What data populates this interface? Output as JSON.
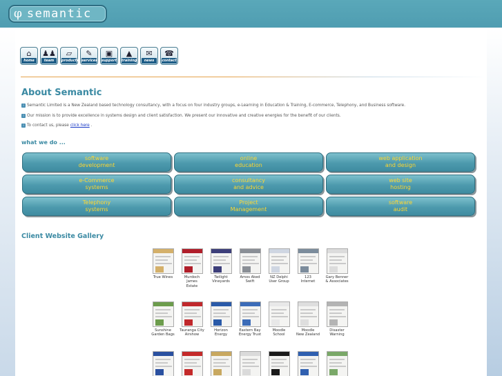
{
  "header": {
    "logo_symbol": "φ",
    "logo_word": "semantic"
  },
  "nav": [
    {
      "label": "home",
      "icon": "house-icon",
      "glyph": "⌂"
    },
    {
      "label": "team",
      "icon": "people-icon",
      "glyph": "♟♟"
    },
    {
      "label": "products",
      "icon": "box-icon",
      "glyph": "▱"
    },
    {
      "label": "services",
      "icon": "tools-icon",
      "glyph": "✎"
    },
    {
      "label": "support",
      "icon": "monitor-icon",
      "glyph": "▣"
    },
    {
      "label": "training",
      "icon": "graduation-cap-icon",
      "glyph": "▲"
    },
    {
      "label": "news",
      "icon": "megaphone-icon",
      "glyph": "✉"
    },
    {
      "label": "contact",
      "icon": "telephone-icon",
      "glyph": "☎"
    }
  ],
  "about": {
    "title": "About Semantic",
    "p1": "Semantic Limited is a New Zealand based technology consultancy, with a focus on four industry groups, e-Learning in Education & Training, E-commerce, Telephony, and Business software.",
    "p2": "Our mission is to provide excellence in systems design and client satisfaction. We present our innovative and creative energies for the benefit of our clients.",
    "p3_prefix": "To contact us, please ",
    "p3_link": "click here",
    "p3_suffix": "."
  },
  "what_we_do": {
    "heading": "what we do ...",
    "services": [
      {
        "line1": "software",
        "line2": "development"
      },
      {
        "line1": "online",
        "line2": "education"
      },
      {
        "line1": "web application",
        "line2": "and design"
      },
      {
        "line1": "e-Commerce",
        "line2": "systems"
      },
      {
        "line1": "consultancy",
        "line2": "and advice"
      },
      {
        "line1": "web site",
        "line2": "hosting"
      },
      {
        "line1": "Telephony",
        "line2": "systems"
      },
      {
        "line1": "Project",
        "line2": "Management"
      },
      {
        "line1": "software",
        "line2": "audit"
      }
    ]
  },
  "gallery": {
    "heading": "Client Website Gallery",
    "rows": [
      [
        {
          "c1": "True Wines",
          "c2": "",
          "c3": "",
          "color": "#d4b06a"
        },
        {
          "c1": "Murdoch",
          "c2": "James",
          "c3": "Estate",
          "color": "#b01e2a"
        },
        {
          "c1": "Twilight",
          "c2": "Vineyards",
          "c3": "",
          "color": "#3d3f7a"
        },
        {
          "c1": "Amos Aked",
          "c2": "Swift",
          "c3": "",
          "color": "#8a8f96"
        },
        {
          "c1": "NZ Delphi",
          "c2": "User Group",
          "c3": "",
          "color": "#cfd6e2"
        },
        {
          "c1": "123",
          "c2": "Internet",
          "c3": "",
          "color": "#7c8c9c"
        },
        {
          "c1": "Gary Benner",
          "c2": "& Associates",
          "c3": "",
          "color": "#dcdcdc"
        }
      ],
      [
        {
          "c1": "Sunshine",
          "c2": "Garden Bags",
          "c3": "",
          "color": "#6c9c4c"
        },
        {
          "c1": "Tauranga City",
          "c2": "Airshow",
          "c3": "",
          "color": "#c0282c"
        },
        {
          "c1": "Horizon",
          "c2": "Energy",
          "c3": "",
          "color": "#2a5aa8"
        },
        {
          "c1": "Eastern Bay",
          "c2": "Energy Trust",
          "c3": "",
          "color": "#3c6cb8"
        },
        {
          "c1": "Moodle",
          "c2": "School",
          "c3": "",
          "color": "#e8e8e8"
        },
        {
          "c1": "Moodle",
          "c2": "New Zealand",
          "c3": "",
          "color": "#dedede"
        },
        {
          "c1": "Disaster",
          "c2": "Warning",
          "c3": "",
          "color": "#b4b4b4"
        }
      ],
      [
        {
          "c1": "",
          "c2": "",
          "c3": "",
          "color": "#2a50a0"
        },
        {
          "c1": "",
          "c2": "",
          "c3": "",
          "color": "#c42a2a"
        },
        {
          "c1": "",
          "c2": "",
          "c3": "",
          "color": "#c8a860"
        },
        {
          "c1": "",
          "c2": "",
          "c3": "",
          "color": "#dadada"
        },
        {
          "c1": "",
          "c2": "",
          "c3": "",
          "color": "#1a1a1a"
        },
        {
          "c1": "",
          "c2": "",
          "c3": "",
          "color": "#3060b0"
        },
        {
          "c1": "",
          "c2": "",
          "c3": "",
          "color": "#7aa868"
        }
      ]
    ]
  },
  "colors": {
    "header": "#4f9db1",
    "accent": "#3b8aa3",
    "button_text": "#ffd72f",
    "link": "#1637c6"
  }
}
